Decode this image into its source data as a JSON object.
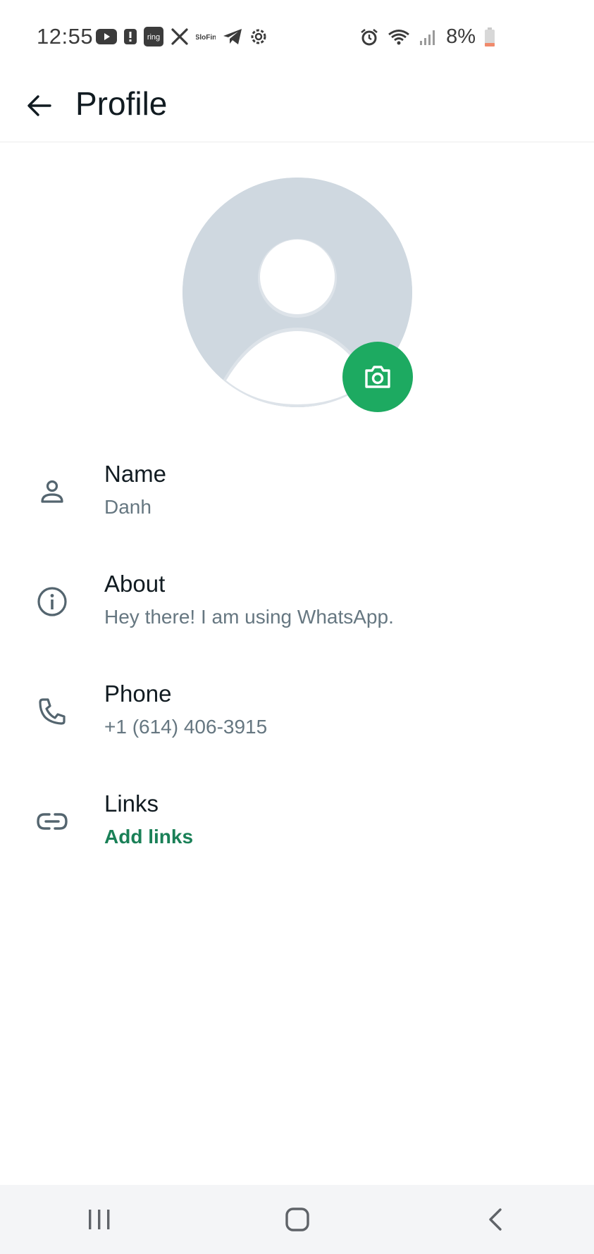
{
  "status_bar": {
    "time": "12:55",
    "left_icons": [
      "youtube-icon",
      "alert-icon",
      "ring-icon",
      "x-icon",
      "slofin-icon",
      "telegram-icon",
      "settings-icon"
    ],
    "right_icons": [
      "alarm-icon",
      "wifi-icon",
      "signal-icon",
      "battery-icon"
    ],
    "ring_text": "ring",
    "slofin_text": "SloFin",
    "battery": "8%"
  },
  "app_bar": {
    "title": "Profile"
  },
  "profile": {
    "rows": [
      {
        "label": "Name",
        "value": "Danh",
        "icon": "person-icon"
      },
      {
        "label": "About",
        "value": "Hey there! I am using WhatsApp.",
        "icon": "info-icon"
      },
      {
        "label": "Phone",
        "value": "+1 (614) 406-3915",
        "icon": "phone-icon"
      },
      {
        "label": "Links",
        "value": "Add links",
        "icon": "link-icon"
      }
    ]
  },
  "colors": {
    "accent": "#1daa61",
    "link": "#1a8057",
    "avatar_bg": "#cfd8e0",
    "secondary_text": "#667781"
  },
  "nav_bar": {
    "buttons": [
      "recent-apps-icon",
      "home-icon",
      "back-icon"
    ]
  }
}
